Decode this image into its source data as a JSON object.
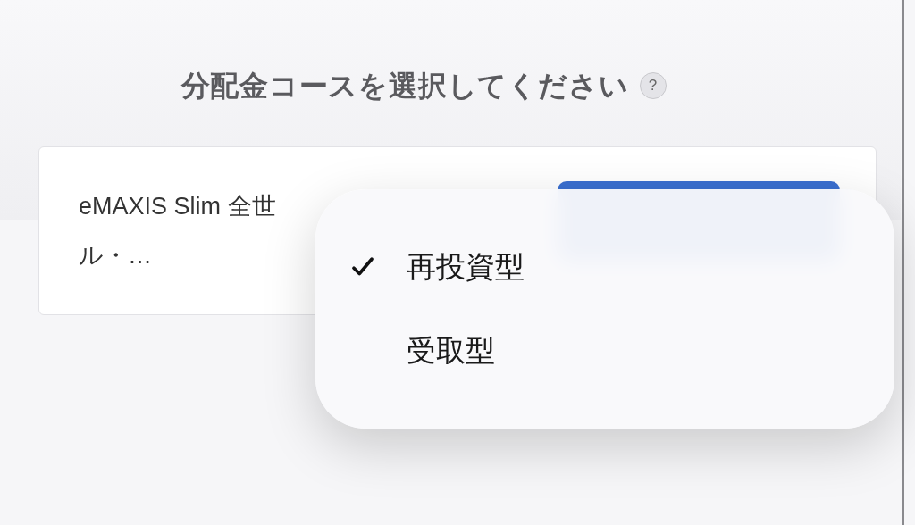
{
  "title": "分配金コースを選択してください",
  "help_icon": "?",
  "fund_card": {
    "name_lines": [
      "eMAXIS Slim 全世",
      "ル・…"
    ]
  },
  "menu": {
    "options": [
      {
        "label": "再投資型",
        "selected": true
      },
      {
        "label": "受取型",
        "selected": false
      }
    ]
  }
}
